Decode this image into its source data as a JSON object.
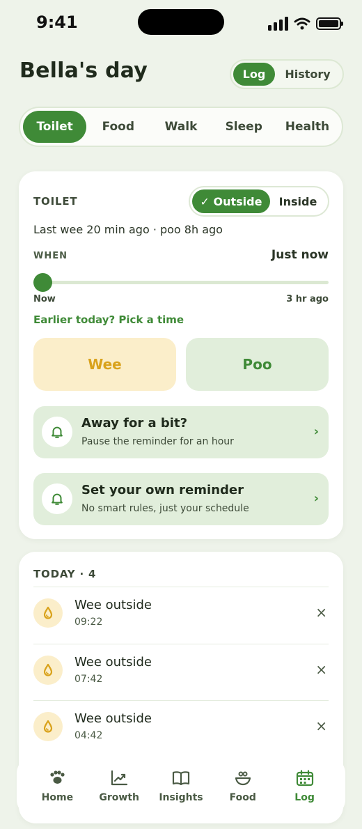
{
  "status_bar": {
    "time": "9:41"
  },
  "header": {
    "title": "Bella's day",
    "mode_toggle": {
      "active": "Log",
      "inactive": "History"
    }
  },
  "categories": [
    "Toilet",
    "Food",
    "Walk",
    "Sleep",
    "Health"
  ],
  "toilet": {
    "section_label": "TOILET",
    "place_toggle": {
      "active": "✓ Outside",
      "inactive": "Inside"
    },
    "last_info": "Last wee 20 min ago · poo 8h ago",
    "when_label": "WHEN",
    "when_value": "Just now",
    "slider": {
      "min_label": "Now",
      "max_label": "3 hr ago",
      "value_fraction": 0
    },
    "pick_time_link": "Earlier today? Pick a time",
    "wee_label": "Wee",
    "poo_label": "Poo",
    "reminders": [
      {
        "title": "Away for a bit?",
        "subtitle": "Pause the reminder for an hour"
      },
      {
        "title": "Set your own reminder",
        "subtitle": "No smart rules, just your schedule"
      }
    ]
  },
  "today": {
    "label": "TODAY · 4",
    "entries": [
      {
        "title": "Wee outside",
        "time": "09:22"
      },
      {
        "title": "Wee outside",
        "time": "07:42"
      },
      {
        "title": "Wee outside",
        "time": "04:42"
      }
    ]
  },
  "nav": {
    "items": [
      {
        "label": "Home",
        "icon": "paw-icon"
      },
      {
        "label": "Growth",
        "icon": "chart-icon"
      },
      {
        "label": "Insights",
        "icon": "book-icon"
      },
      {
        "label": "Food",
        "icon": "bowl-icon"
      },
      {
        "label": "Log",
        "icon": "calendar-icon"
      }
    ],
    "active": "Log"
  },
  "colors": {
    "accent": "#3f8a37",
    "background": "#eef3ea",
    "wee": "#d9a21b",
    "wee_bg": "#fbeeca",
    "soft_green": "#e1eedb"
  }
}
